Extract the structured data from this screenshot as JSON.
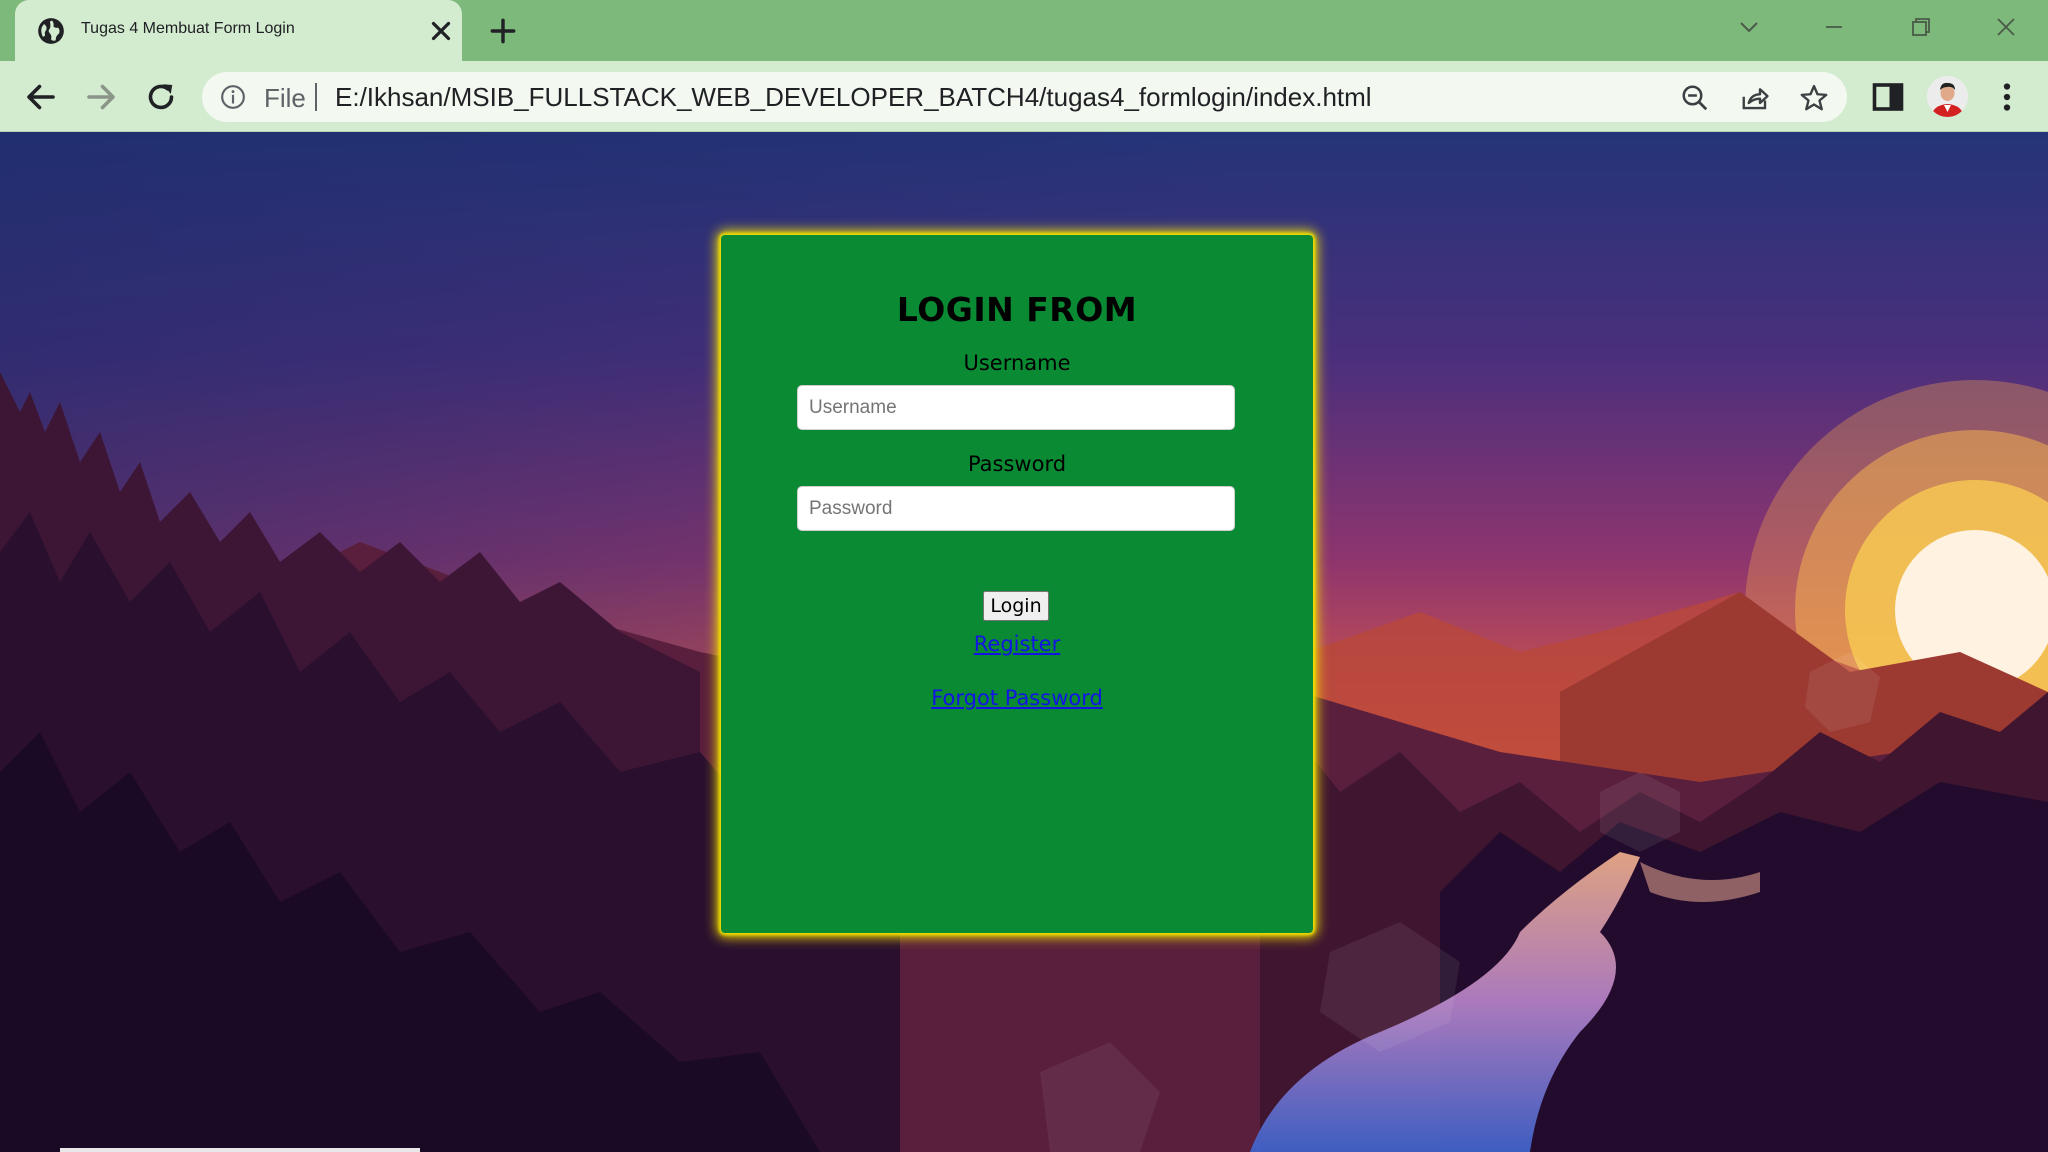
{
  "browser": {
    "tab_title": "Tugas 4 Membuat Form Login",
    "address_scheme_label": "File",
    "address_url": "E:/Ikhsan/MSIB_FULLSTACK_WEB_DEVELOPER_BATCH4/tugas4_formlogin/index.html",
    "colors": {
      "frame": "#7db97a",
      "toolbar": "#d3ebcf"
    }
  },
  "form": {
    "title": "LOGIN FROM",
    "username_label": "Username",
    "username_placeholder": "Username",
    "username_value": "",
    "password_label": "Password",
    "password_placeholder": "Password",
    "password_value": "",
    "login_button": "Login",
    "register_link": "Register",
    "forgot_link": "Forgot Password",
    "colors": {
      "card": "#0a8a33",
      "glow": "#f2df00",
      "link": "#1414e6"
    }
  }
}
